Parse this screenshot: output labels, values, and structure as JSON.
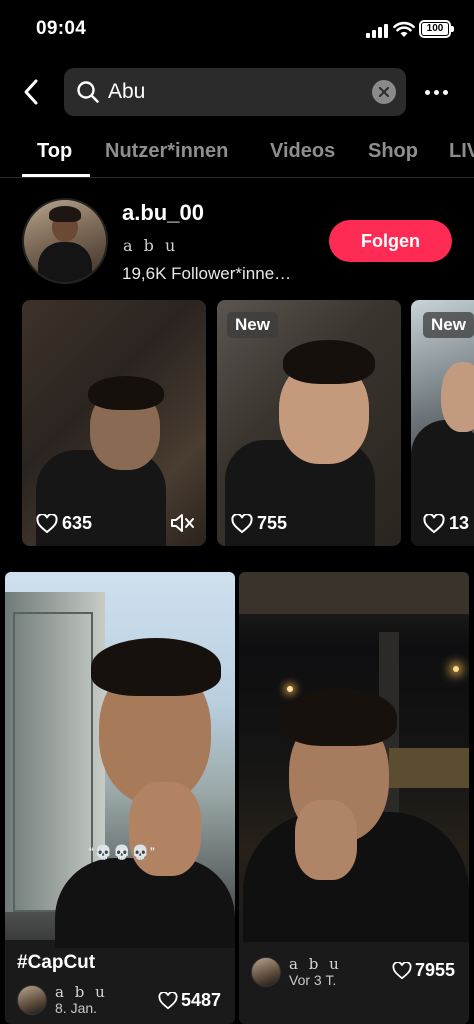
{
  "status": {
    "time": "09:04",
    "battery": "100"
  },
  "search": {
    "query": "Abu"
  },
  "tabs": [
    "Top",
    "Nutzer*innen",
    "Videos",
    "Shop",
    "LIVE"
  ],
  "profile": {
    "username": "a.bu_00",
    "nickname": "a b u",
    "followers": "19,6K Follower*inne…",
    "follow_label": "Folgen"
  },
  "videos": [
    {
      "likes": "635",
      "badge": ""
    },
    {
      "likes": "755",
      "badge": "New"
    },
    {
      "likes": "13",
      "badge": "New"
    }
  ],
  "grid": [
    {
      "caption": "#CapCut",
      "author": "a b u",
      "date": "8. Jan.",
      "likes": "5487",
      "overlay_text": "“💀💀💀”"
    },
    {
      "caption": "",
      "author": "a b u",
      "date": "Vor 3 T.",
      "likes": "7955"
    }
  ]
}
